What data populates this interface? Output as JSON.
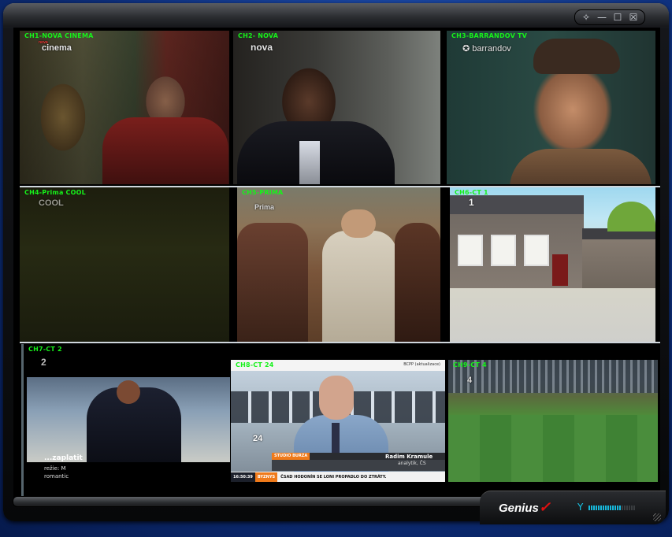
{
  "window": {
    "controls": {
      "pin": "✧",
      "minimize": "—",
      "maximize": "☐",
      "close": "☒"
    }
  },
  "channels": [
    {
      "label": "CH1-NOVA CINEMA",
      "logo": "cinema",
      "logo_top": "nova"
    },
    {
      "label": "CH2- NOVA",
      "logo": "nova"
    },
    {
      "label": "CH3-BARRANDOV TV",
      "logo": "✪ barrandov"
    },
    {
      "label": "CH4-Prima COOL",
      "logo": "COOL"
    },
    {
      "label": "CH5-PRIMA",
      "logo": "Prima"
    },
    {
      "label": "CH6-CT 1",
      "logo": "1"
    },
    {
      "label": "CH7-CT 2",
      "logo": "2",
      "overlay_title": "...zaplatit",
      "overlay_line1": "režie: M",
      "overlay_line2": "romantic"
    },
    {
      "label": "CH8-CT 24",
      "logo": "24",
      "top_right": "BCPP (aktualizace)",
      "studio": "STUDIO BURZA",
      "name": "Radim Kramule",
      "role": "analytik, ČS",
      "time": "16:50:39",
      "section": "BYZNYS",
      "headline": "ČSAD HODONÍN SE LONI PROPADLO DO ZTRÁTY."
    },
    {
      "label": "CH9-CT 4",
      "logo": "4"
    }
  ],
  "footer": {
    "brand": "Genius",
    "signal_icon": "antenna-icon"
  }
}
